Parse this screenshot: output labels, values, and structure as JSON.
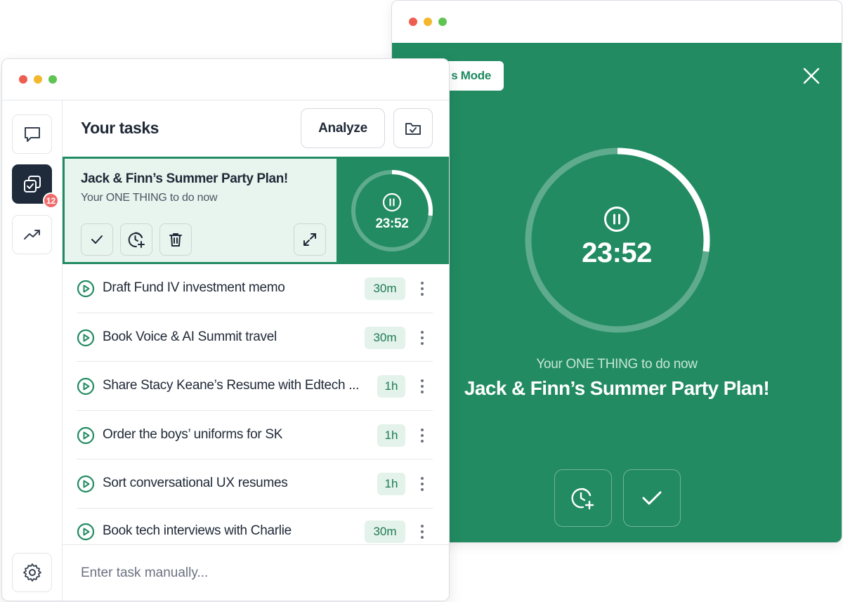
{
  "focus_window": {
    "mode_label": "s Mode",
    "timer": "23:52",
    "progress": 0.27,
    "subtitle": "Your ONE THING to do now",
    "title": "Jack & Finn’s Summer Party Plan!",
    "colors": {
      "background": "#228b62",
      "accent": "#ffffff"
    }
  },
  "task_window": {
    "header_title": "Your tasks",
    "analyze_label": "Analyze",
    "sidebar": {
      "badge_count": "12"
    },
    "current": {
      "title": "Jack & Finn’s Summer Party Plan!",
      "subtitle": "Your ONE THING to do now",
      "timer": "23:52",
      "progress": 0.27
    },
    "tasks": [
      {
        "label": "Draft Fund IV investment memo",
        "duration": "30m"
      },
      {
        "label": "Book Voice & AI Summit travel",
        "duration": "30m"
      },
      {
        "label": "Share Stacy Keane’s Resume with Edtech ...",
        "duration": "1h"
      },
      {
        "label": "Order the boys’ uniforms for SK",
        "duration": "1h"
      },
      {
        "label": "Sort conversational UX resumes",
        "duration": "1h"
      },
      {
        "label": "Book tech interviews with Charlie",
        "duration": "30m"
      }
    ],
    "input_placeholder": "Enter task manually..."
  }
}
